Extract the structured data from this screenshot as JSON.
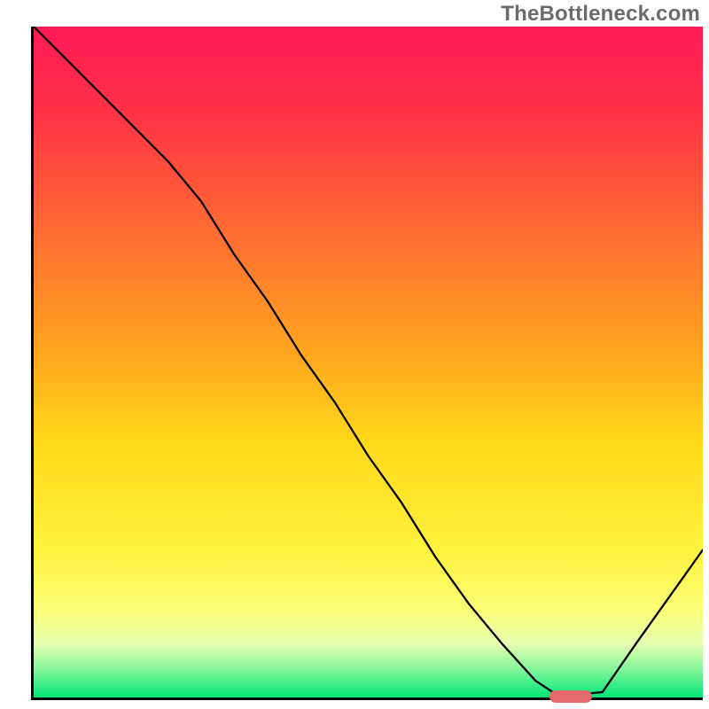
{
  "watermark": "TheBottleneck.com",
  "chart_data": {
    "type": "line",
    "title": "",
    "xlabel": "",
    "ylabel": "",
    "xlim": [
      0,
      100
    ],
    "ylim": [
      0,
      100
    ],
    "x": [
      0,
      5,
      10,
      15,
      20,
      25,
      30,
      35,
      40,
      45,
      50,
      55,
      60,
      65,
      70,
      75,
      78,
      82,
      85,
      90,
      95,
      100
    ],
    "values": [
      100,
      95,
      90,
      85,
      80,
      74,
      66,
      59,
      51,
      44,
      36,
      29,
      21,
      14,
      8,
      2.5,
      0.5,
      0.5,
      0.8,
      8,
      15,
      22
    ],
    "optimum_x": 80,
    "optimum_y": 0.5,
    "gradient_stops": [
      {
        "offset": 0,
        "color": "#ff1a55"
      },
      {
        "offset": 0.13,
        "color": "#ff3246"
      },
      {
        "offset": 0.3,
        "color": "#ff6a33"
      },
      {
        "offset": 0.48,
        "color": "#ffa41f"
      },
      {
        "offset": 0.62,
        "color": "#ffd81a"
      },
      {
        "offset": 0.78,
        "color": "#fff23e"
      },
      {
        "offset": 0.87,
        "color": "#fcff78"
      },
      {
        "offset": 0.92,
        "color": "#e6ffb0"
      },
      {
        "offset": 0.96,
        "color": "#80f59a"
      },
      {
        "offset": 1.0,
        "color": "#00e676"
      }
    ],
    "line_color": "#000000",
    "line_width": 2.3,
    "marker_color": "#e46a6a"
  }
}
